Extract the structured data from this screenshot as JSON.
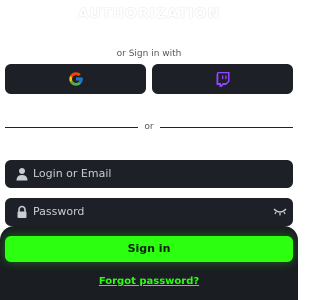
{
  "title": "AUTHORIZATION",
  "social": {
    "or_text": "or Sign in with",
    "google": {
      "icon": "google-icon"
    },
    "twitch": {
      "icon": "twitch-icon",
      "color": "#9146ff"
    }
  },
  "divider": {
    "text": "or"
  },
  "form": {
    "login": {
      "placeholder": "Login or Email",
      "value": "",
      "icon": "user-icon"
    },
    "password": {
      "placeholder": "Password",
      "value": "",
      "icon": "lock-icon",
      "toggle_icon": "eye-closed-icon"
    }
  },
  "actions": {
    "signin_label": "Sign in",
    "forgot_label": "Forgot password?",
    "accent_color": "#2dff10"
  },
  "colors": {
    "background": "#ffffff",
    "input_background": "#1d2026",
    "panel_background": "#1a1d22"
  }
}
